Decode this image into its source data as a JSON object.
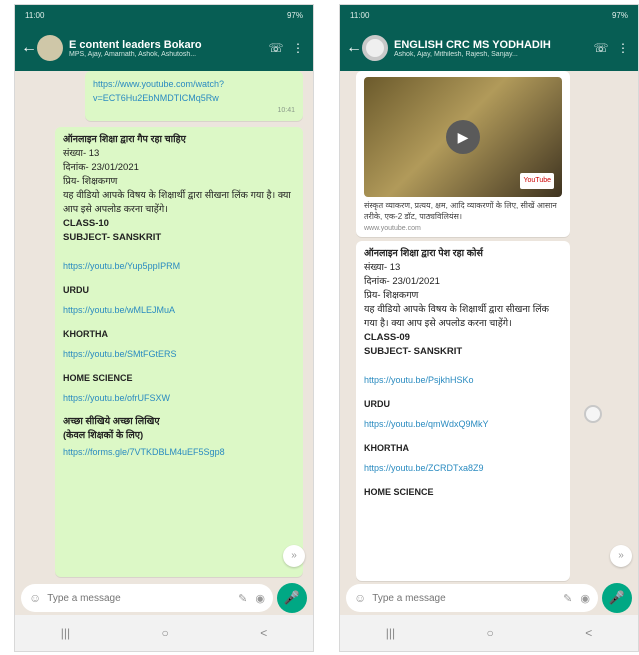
{
  "left": {
    "status": {
      "time": "11:00",
      "signal": "97%"
    },
    "chat_title": "E content leaders Bokaro",
    "chat_subtitle": "MPS, Ajay, Amarnath, Ashok, Ashutosh...",
    "top_link": "https://www.youtube.com/watch?v=ECT6Hu2EbNMDTICMq5Rw",
    "top_time": "10:41",
    "message": {
      "heading": "ऑनलाइन शिक्षा द्वारा गैप रहा चाहिए",
      "line1": "संख्या- 13",
      "line2": "दिनांक- 23/01/2021",
      "line3": "प्रिय- शिक्षकगण",
      "line4": "यह वीडियो आपके विषय के शिक्षार्थी द्वारा सीखना लिंक गया है। क्या आप इसे अपलोड करना चाहेंगे।",
      "class": "CLASS-10",
      "subject": "SUBJECT- SANSKRIT",
      "link1": "https://youtu.be/Yup5ppIPRM",
      "urdu": "URDU",
      "link2": "https://youtu.be/wMLEJMuA",
      "khortha": "KHORTHA",
      "link3": "https://youtu.be/SMtFGtERS",
      "home_science": "HOME SCIENCE",
      "link4": "https://youtu.be/ofrUFSXW",
      "footer1": "अच्छा सीखिये अच्छा लिखिए",
      "footer2": "(केवल शिक्षकों के लिए)",
      "link5": "https://forms.gle/7VTKDBLM4uEF5Sgp8"
    },
    "composer_placeholder": "Type a message",
    "nav": {
      "recent": "|||",
      "home": "○",
      "back": "<"
    }
  },
  "right": {
    "status": {
      "time": "11:00",
      "signal": "97%"
    },
    "chat_title": "ENGLISH CRC MS YODHADIH",
    "chat_subtitle": "Ashok, Ajay, Mithilesh, Rajesh, Sanjay...",
    "video_caption": "संस्कृत व्याकरण, प्रत्यय, क्षम, आदि व्याकरणों के लिए, सीखें आसान तरीके, एक-2 डॉट, पाठ्यविलियंस।",
    "video_url": "www.youtube.com",
    "yt_label": "YouTube",
    "message": {
      "heading": "ऑनलाइन शिक्षा द्वारा पेश रहा कोर्स",
      "line1": "संख्या- 13",
      "line2": "दिनांक- 23/01/2021",
      "line3": "प्रिय- शिक्षकगण",
      "line4": "यह वीडियो आपके विषय के शिक्षार्थी द्वारा सीखना लिंक गया है। क्या आप इसे अपलोड करना चाहेंगे।",
      "class": "CLASS-09",
      "subject": "SUBJECT- SANSKRIT",
      "link1": "https://youtu.be/PsjkhHSKo",
      "urdu": "URDU",
      "link2": "https://youtu.be/qmWdxQ9MkY",
      "khortha": "KHORTHA",
      "link3": "https://youtu.be/ZCRDTxa8Z9",
      "home_science": "HOME SCIENCE"
    },
    "composer_placeholder": "Type a message",
    "nav": {
      "recent": "|||",
      "home": "○",
      "back": "<"
    }
  }
}
